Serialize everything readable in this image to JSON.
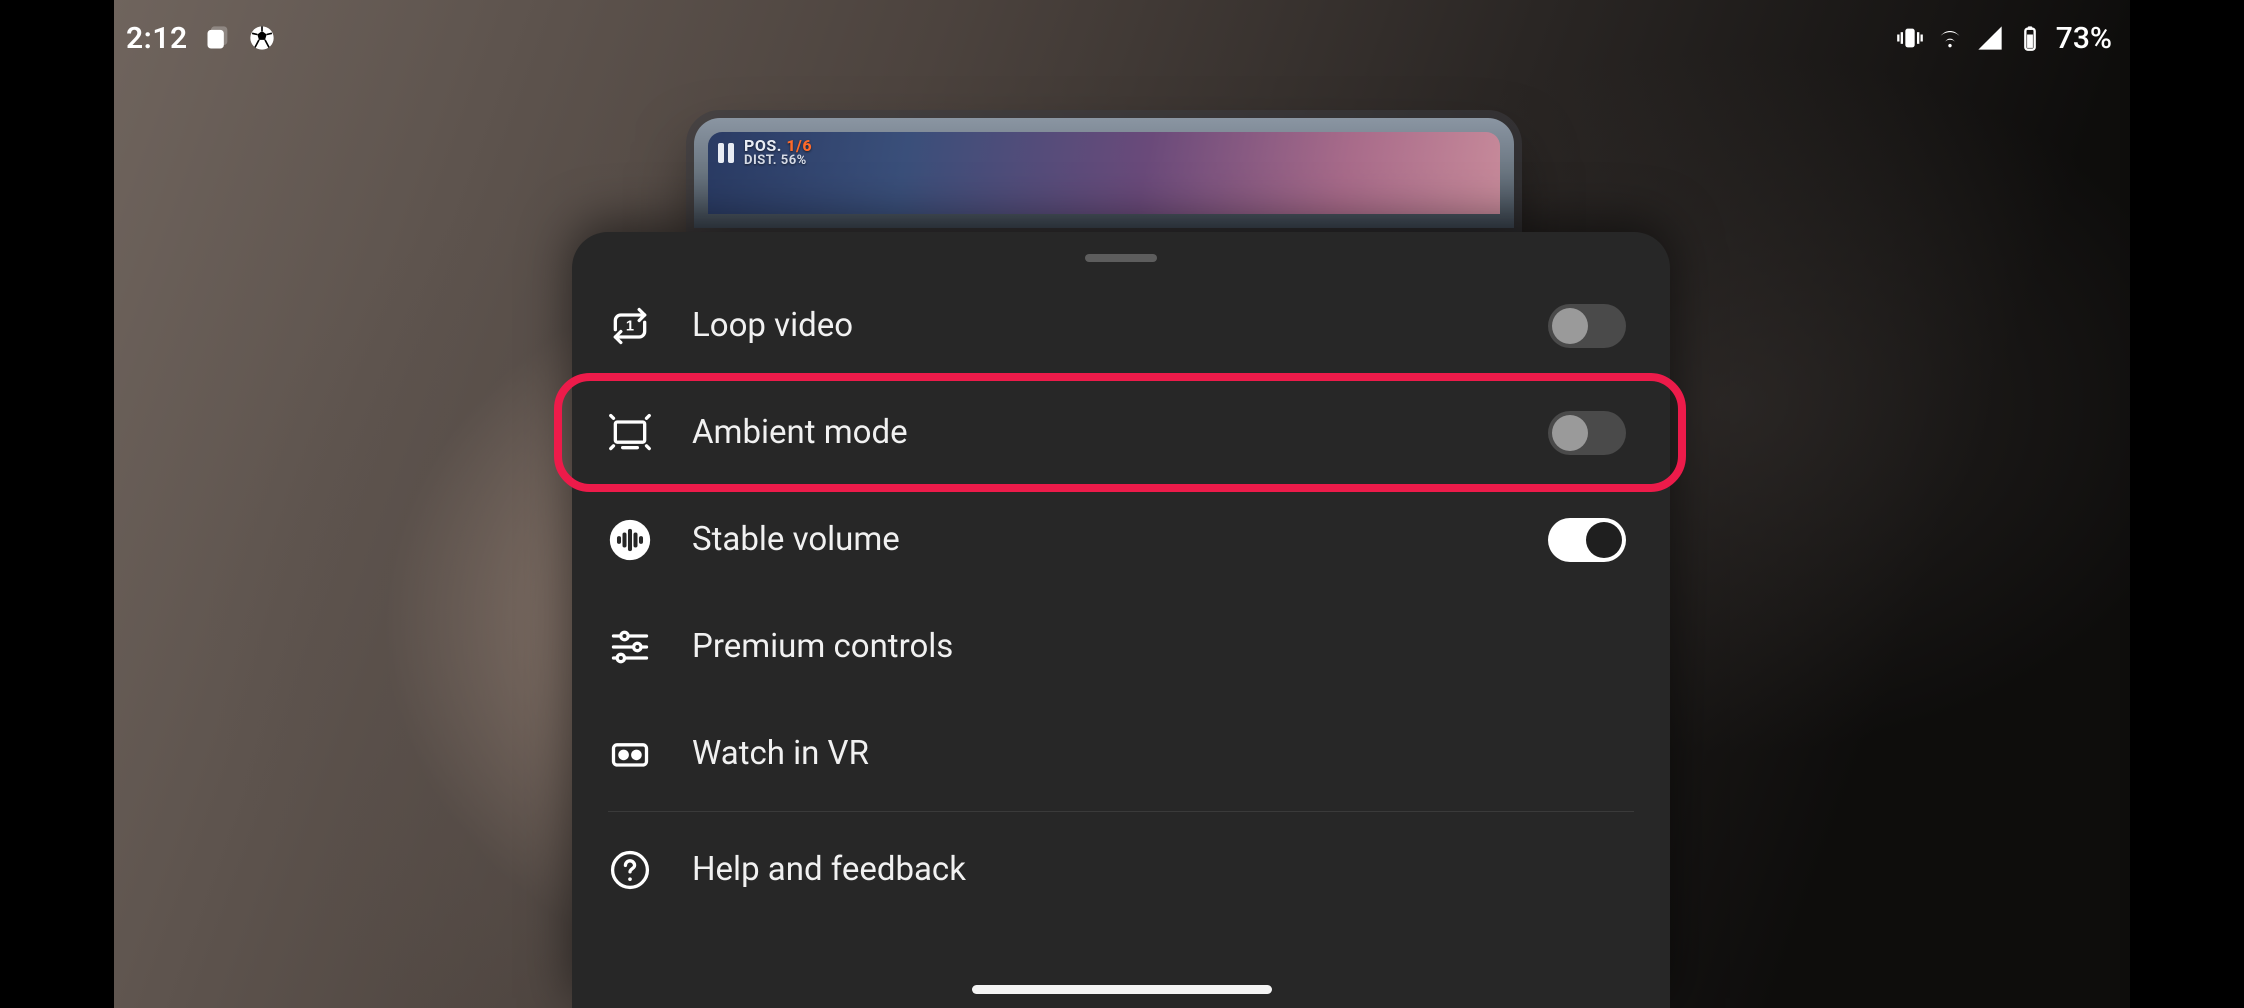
{
  "status": {
    "clock": "2:12",
    "battery_pct": "73%"
  },
  "video_hud": {
    "pos_label": "POS.",
    "pos_value": "1/6",
    "dist_label": "DIST.",
    "dist_value": "56%"
  },
  "menu": {
    "loop": {
      "label": "Loop video",
      "on": false,
      "has_toggle": true
    },
    "ambient": {
      "label": "Ambient mode",
      "on": false,
      "has_toggle": true
    },
    "stable_vol": {
      "label": "Stable volume",
      "on": true,
      "has_toggle": true
    },
    "premium": {
      "label": "Premium controls",
      "has_toggle": false
    },
    "vr": {
      "label": "Watch in VR",
      "has_toggle": false
    },
    "help": {
      "label": "Help and feedback",
      "has_toggle": false
    }
  }
}
